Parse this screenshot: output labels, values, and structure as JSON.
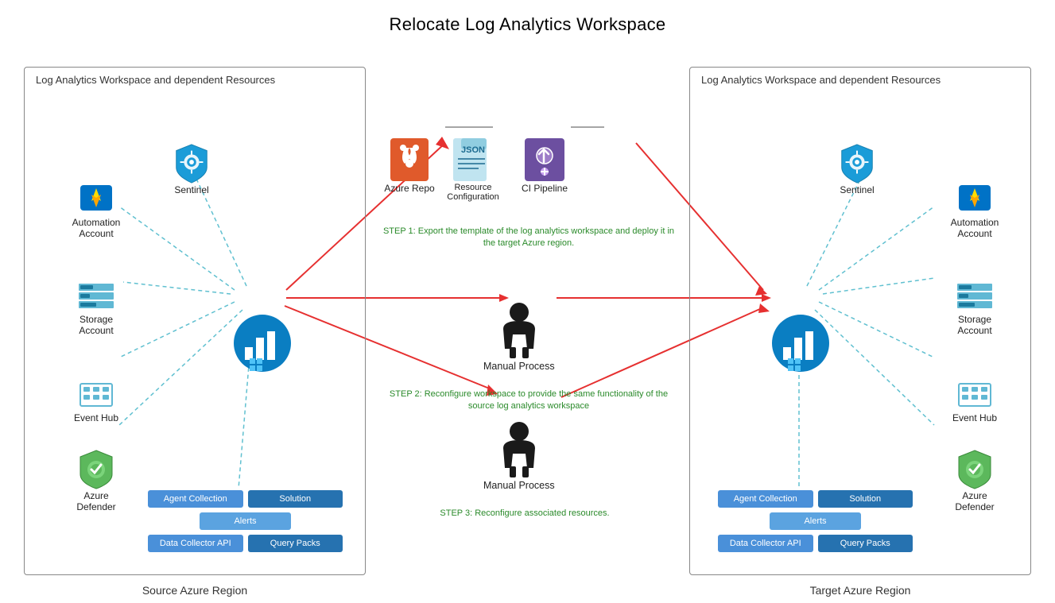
{
  "title": "Relocate Log Analytics Workspace",
  "left_region": {
    "label": "Log Analytics Workspace and dependent Resources",
    "sublabel": "Source Azure Region",
    "sentinel": "Sentinel",
    "automation": "Automation\nAccount",
    "storage": "Storage\nAccount",
    "eventhub": "Event Hub",
    "defender": "Azure\nDefender",
    "tiles": {
      "row1": [
        "Agent Collection",
        "Solution"
      ],
      "row2": [
        "Alerts"
      ],
      "row3": [
        "Data Collector API",
        "Query Packs"
      ]
    }
  },
  "right_region": {
    "label": "Log Analytics Workspace and dependent Resources",
    "sublabel": "Target Azure Region",
    "sentinel": "Sentinel",
    "automation": "Automation\nAccount",
    "storage": "Storage\nAccount",
    "eventhub": "Event Hub",
    "defender": "Azure\nDefender",
    "tiles": {
      "row1": [
        "Agent Collection",
        "Solution"
      ],
      "row2": [
        "Alerts"
      ],
      "row3": [
        "Data Collector API",
        "Query Packs"
      ]
    }
  },
  "center": {
    "azure_repo": "Azure Repo",
    "resource_config": "Resource\nConfiguration",
    "ci_pipeline": "CI Pipeline",
    "step1_text": "STEP 1: Export the template of the log analytics workspace and\ndeploy it in the target Azure region.",
    "manual_process1": "Manual Process",
    "step2_text": "STEP 2: Reconfigure workspace to provide the same\nfunctionality of the source log analytics workspace",
    "manual_process2": "Manual Process",
    "step3_text": "STEP 3: Reconfigure associated resources."
  }
}
